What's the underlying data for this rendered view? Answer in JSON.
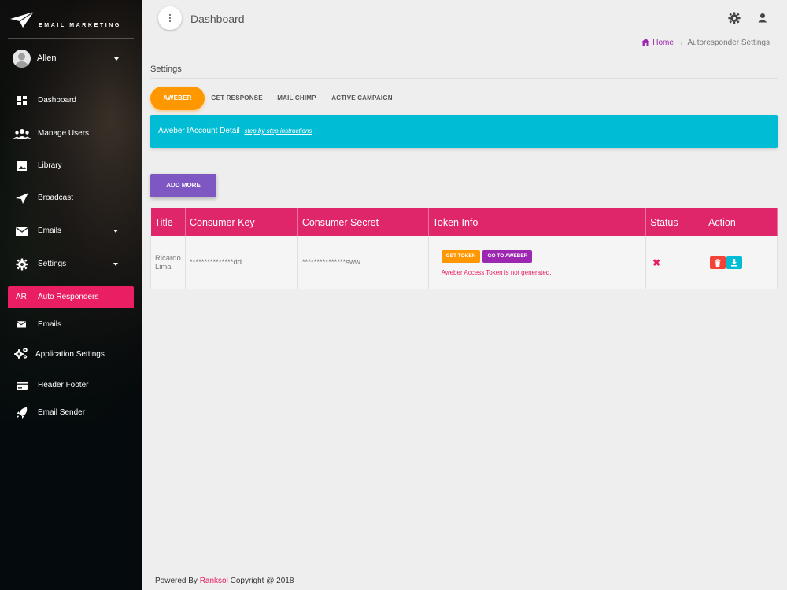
{
  "brand": {
    "name": "EMAIL MARKETING",
    "logo_icon": "paper-plane-icon"
  },
  "user": {
    "name": "Allen"
  },
  "sidebar": {
    "items": [
      {
        "label": "Dashboard",
        "icon": "dashboard-icon"
      },
      {
        "label": "Manage Users",
        "icon": "users-icon"
      },
      {
        "label": "Library",
        "icon": "image-icon"
      },
      {
        "label": "Broadcast",
        "icon": "send-icon"
      },
      {
        "label": "Emails",
        "icon": "mail-icon",
        "has_caret": true
      },
      {
        "label": "Settings",
        "icon": "gear-icon",
        "has_caret": true
      },
      {
        "label": "Auto Responders",
        "abbr": "AR",
        "active": true
      },
      {
        "label": "Emails",
        "icon": "mail-icon"
      },
      {
        "label": "Application Settings",
        "icon": "cogs-icon"
      },
      {
        "label": "Header Footer",
        "icon": "card-icon"
      },
      {
        "label": "Email Sender",
        "icon": "rocket-icon"
      }
    ]
  },
  "header": {
    "title": "Dashboard"
  },
  "breadcrumb": {
    "home": "Home",
    "current": "Autoresponder Settings"
  },
  "settings": {
    "title": "Settings"
  },
  "tabs": [
    {
      "label": "AWEBER",
      "active": true
    },
    {
      "label": "GET RESPONSE"
    },
    {
      "label": "MAIL CHIMP"
    },
    {
      "label": "ACTIVE CAMPAIGN"
    }
  ],
  "info": {
    "text": "Aweber IAccount Detail",
    "link": "step by step instructions"
  },
  "add_button": "ADD MORE",
  "table": {
    "headers": [
      "Title",
      "Consumer Key",
      "Consumer Secret",
      "Token Info",
      "Status",
      "Action"
    ],
    "rows": [
      {
        "title": "Ricardo Lima",
        "consumer_key": "***************dd",
        "consumer_secret": "***************sww",
        "get_token": "GET TOKEN",
        "go_to": "GO TO AWEBER",
        "token_message": "Aweber Access Token is not generated.",
        "status": "✖"
      }
    ]
  },
  "footer": {
    "prefix": "Powered By",
    "brand": "Ranksol",
    "suffix": "Copyright @ 2018"
  },
  "colors": {
    "accent_pink": "#e91e63",
    "orange": "#ff9800",
    "cyan": "#00bcd4",
    "purple": "#7e57c2"
  }
}
